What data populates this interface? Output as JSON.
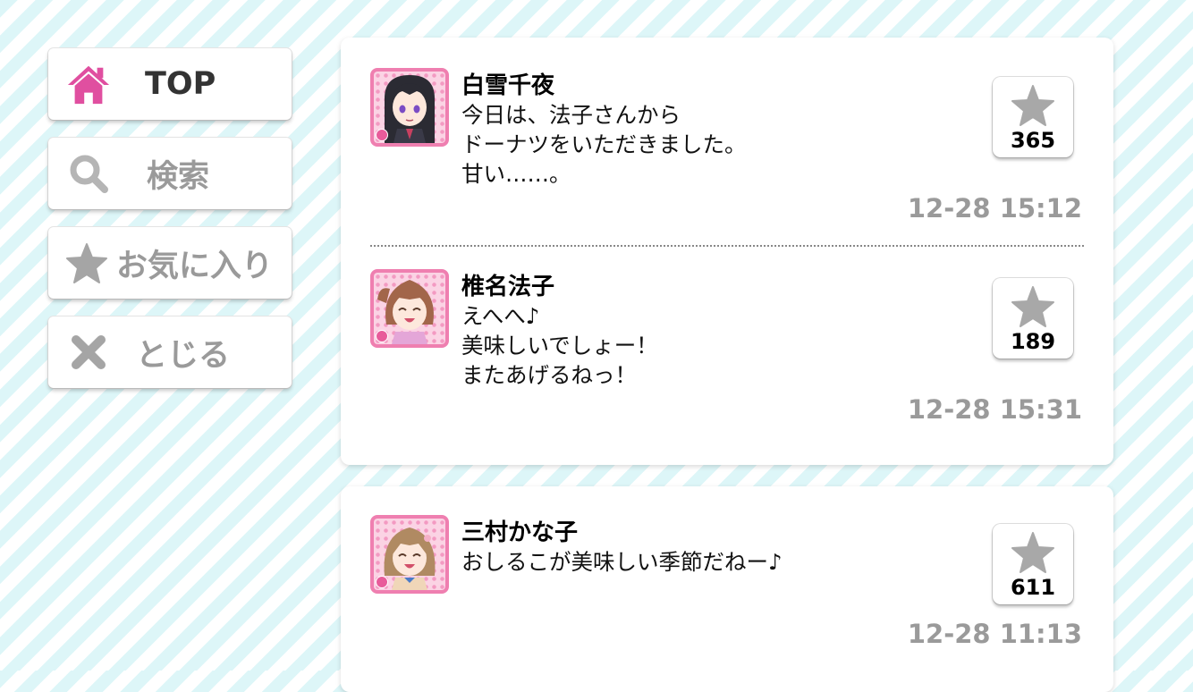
{
  "menu": {
    "top_label": "TOP",
    "search_label": "検索",
    "favorites_label": "お気に入り",
    "close_label": "とじる"
  },
  "posts": [
    {
      "name": "白雪千夜",
      "lines": [
        "今日は、法子さんから",
        "ドーナツをいただきました。",
        "甘い……。"
      ],
      "likes": "365",
      "time": "12-28 15:12"
    },
    {
      "name": "椎名法子",
      "lines": [
        "えへへ♪",
        "美味しいでしょー！",
        "またあげるねっ！"
      ],
      "likes": "189",
      "time": "12-28 15:31"
    },
    {
      "name": "三村かな子",
      "lines": [
        "おしるこが美味しい季節だねー♪"
      ],
      "likes": "611",
      "time": "12-28 11:13"
    }
  ],
  "colors": {
    "accent": "#e04fa0",
    "inactive": "#9a9a9a",
    "stripe": "#ddf6f8"
  },
  "icons": [
    "home-icon",
    "search-icon",
    "star-icon",
    "close-icon"
  ]
}
